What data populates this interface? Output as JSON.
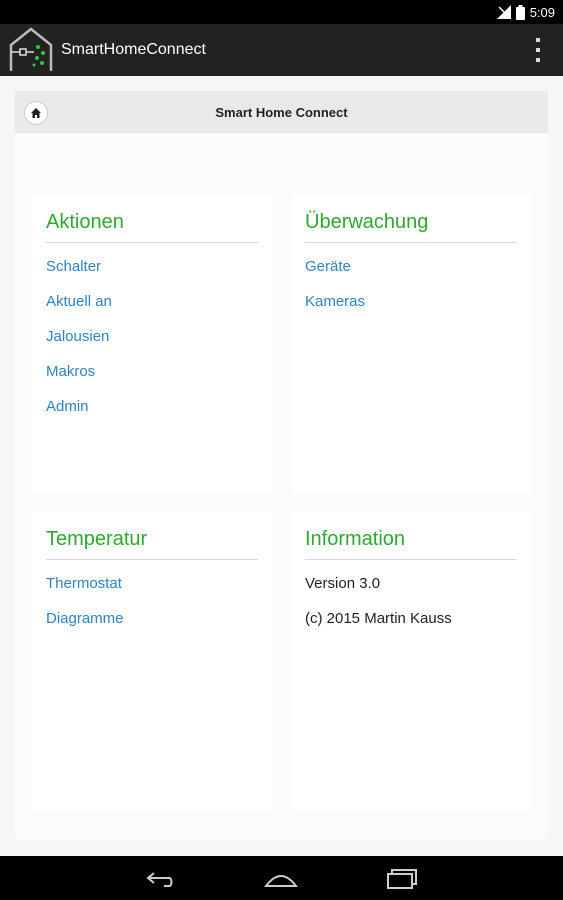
{
  "status_bar": {
    "time": "5:09",
    "icons": [
      "signal-icon",
      "battery-icon"
    ]
  },
  "action_bar": {
    "app_title": "SmartHomeConnect",
    "icon": "smart-home-logo-icon"
  },
  "page": {
    "title": "Smart Home Connect",
    "home_icon": "home-icon"
  },
  "cards": {
    "aktionen": {
      "title": "Aktionen",
      "links": [
        "Schalter",
        "Aktuell an",
        "Jalousien",
        "Makros",
        "Admin"
      ]
    },
    "ueberwachung": {
      "title": "Überwachung",
      "links": [
        "Geräte",
        "Kameras"
      ]
    },
    "temperatur": {
      "title": "Temperatur",
      "links": [
        "Thermostat",
        "Diagramme"
      ]
    },
    "information": {
      "title": "Information",
      "lines": [
        "Version 3.0",
        "(c) 2015 Martin Kauss"
      ]
    }
  },
  "colors": {
    "accent_green": "#2ea82e",
    "link_blue": "#2f83c5",
    "action_bar": "#222222"
  }
}
